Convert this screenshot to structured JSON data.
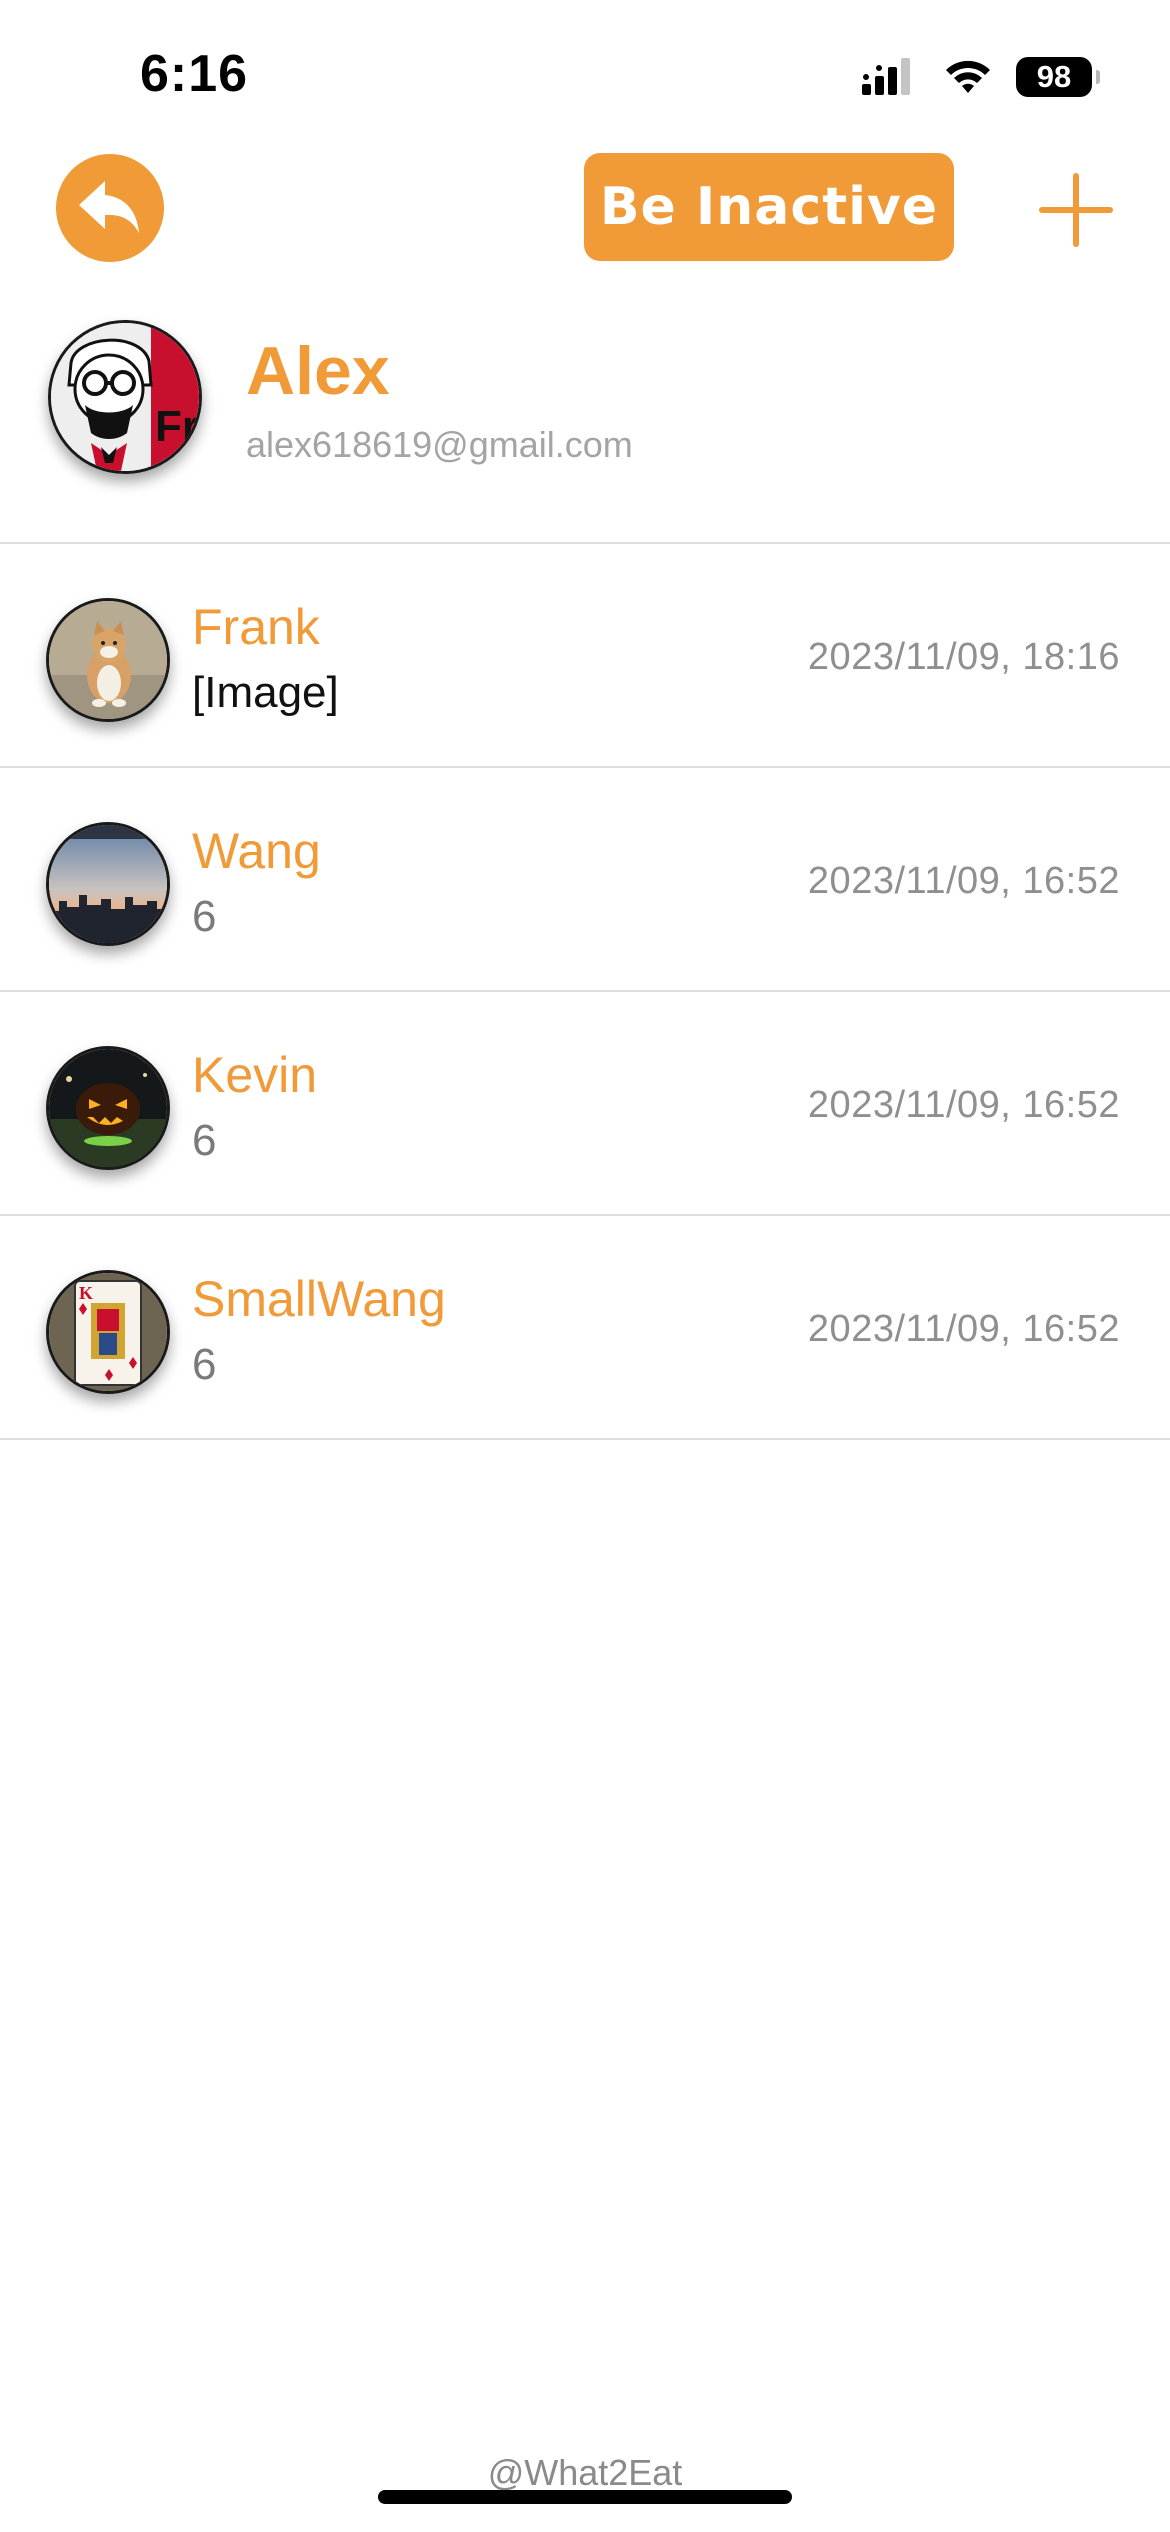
{
  "status_bar": {
    "time": "6:16",
    "battery": "98",
    "icons": [
      "cellular-signal-icon",
      "wifi-icon",
      "battery-icon"
    ]
  },
  "header": {
    "back_icon": "back-arrow-icon",
    "inactive_label": "Be Inactive",
    "add_icon": "plus-icon"
  },
  "profile": {
    "name": "Alex",
    "email": "alex618619@gmail.com",
    "avatar": "kfc-colonel-avatar"
  },
  "chats": [
    {
      "name": "Frank",
      "preview": "[Image]",
      "time": "2023/11/09, 18:16",
      "avatar": "cat-avatar"
    },
    {
      "name": "Wang",
      "preview": "6",
      "time": "2023/11/09, 16:52",
      "avatar": "city-skyline-avatar"
    },
    {
      "name": "Kevin",
      "preview": "6",
      "time": "2023/11/09, 16:52",
      "avatar": "pumpkin-avatar"
    },
    {
      "name": "SmallWang",
      "preview": "6",
      "time": "2023/11/09, 16:52",
      "avatar": "playing-card-avatar"
    }
  ],
  "footer": {
    "credit": "@What2Eat"
  },
  "colors": {
    "accent": "#f09a38",
    "divider": "#dedede",
    "secondary_text": "#8f8f8f"
  }
}
